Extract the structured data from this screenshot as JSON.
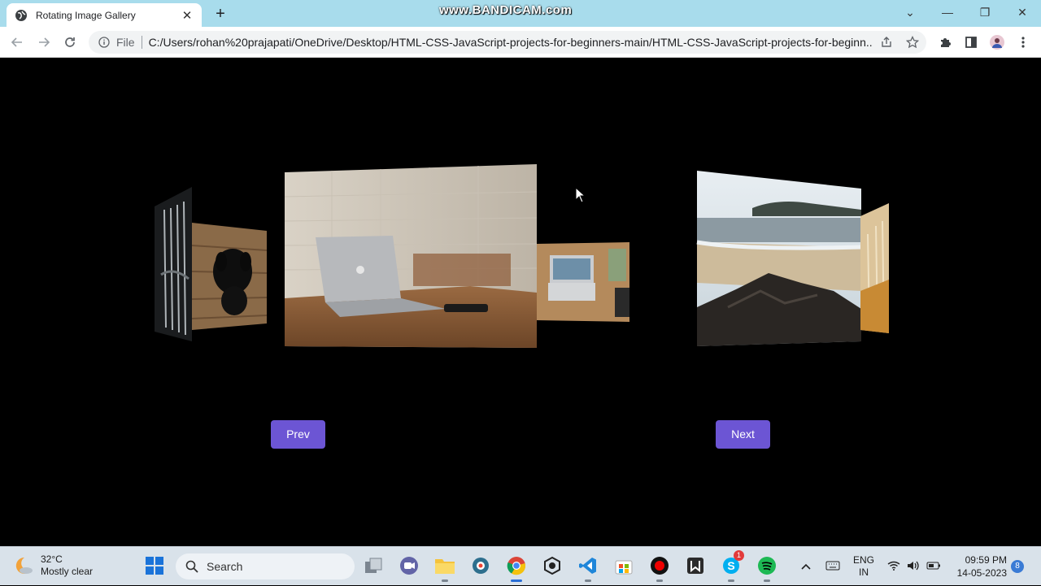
{
  "browser": {
    "tab_title": "Rotating Image Gallery",
    "tab_close": "✕",
    "new_tab": "+",
    "watermark": "www.BANDICAM.com",
    "url_scheme": "File",
    "url": "C:/Users/rohan%20prajapati/OneDrive/Desktop/HTML-CSS-JavaScript-projects-for-beginners-main/HTML-CSS-JavaScript-projects-for-beginn...",
    "window_controls": {
      "dropdown": "⌄",
      "minimize": "—",
      "restore": "❐",
      "close": "✕"
    }
  },
  "gallery": {
    "prev_label": "Prev",
    "next_label": "Next",
    "images": [
      {
        "name": "forks"
      },
      {
        "name": "black-dog"
      },
      {
        "name": "laptop-on-desk"
      },
      {
        "name": "laptop-topdown"
      },
      {
        "name": "beach-rocks"
      },
      {
        "name": "wheat-fence"
      }
    ]
  },
  "taskbar": {
    "weather_temp": "32°C",
    "weather_desc": "Mostly clear",
    "search_label": "Search",
    "language_top": "ENG",
    "language_bottom": "IN",
    "time": "09:59 PM",
    "date": "14-05-2023",
    "notification_count": "8",
    "skype_badge": "1"
  },
  "colors": {
    "button": "#6c55d4",
    "titlebar": "#a8dcec",
    "taskbar": "#d9e2ea"
  }
}
